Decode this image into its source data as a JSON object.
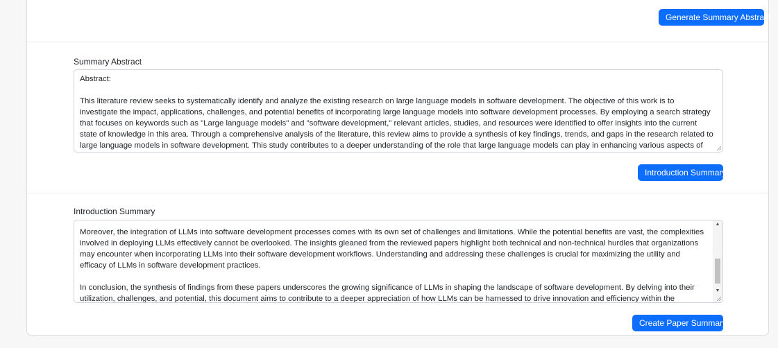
{
  "buttons": {
    "generate_summary_abstract": "Generate Summary Abstract",
    "introduction_summary": "Introduction Summary",
    "create_paper_summary": "Create Paper Summary"
  },
  "summary_abstract": {
    "label": "Summary Abstract",
    "text": "Abstract:\n\nThis literature review seeks to systematically identify and analyze the existing research on large language models in software development. The objective of this work is to investigate the impact, applications, challenges, and potential benefits of incorporating large language models into software development processes. By employing a search strategy that focuses on keywords such as \"Large language models\" and \"software development,\" relevant articles, studies, and resources were identified to offer insights into the current state of knowledge in this area. Through a comprehensive analysis of the literature, this review aims to provide a synthesis of key findings, trends, and gaps in the research related to large language models in software development. This study contributes to a deeper understanding of the role that large language models can play in enhancing various aspects of software development practices, and provides directions for future research in this rapidly evolving field."
  },
  "introduction_summary": {
    "label": "Introduction Summary",
    "text": "Moreover, the integration of LLMs into software development processes comes with its own set of challenges and limitations. While the potential benefits are vast, the complexities involved in deploying LLMs effectively cannot be overlooked. The insights gleaned from the reviewed papers highlight both technical and non-technical hurdles that organizations may encounter when incorporating LLMs into their software development workflows. Understanding and addressing these challenges is crucial for maximizing the utility and efficacy of LLMs in software development practices.\n\nIn conclusion, the synthesis of findings from these papers underscores the growing significance of LLMs in shaping the landscape of software development. By delving into their utilization, challenges, and potential, this document aims to contribute to a deeper appreciation of how LLMs can be harnessed to drive innovation and efficiency within the software development domain.",
    "scroll_position": 0.72
  },
  "colors": {
    "primary_button": "#0d6efd",
    "card_border": "#dadde1",
    "page_background": "#f7f7f8"
  }
}
